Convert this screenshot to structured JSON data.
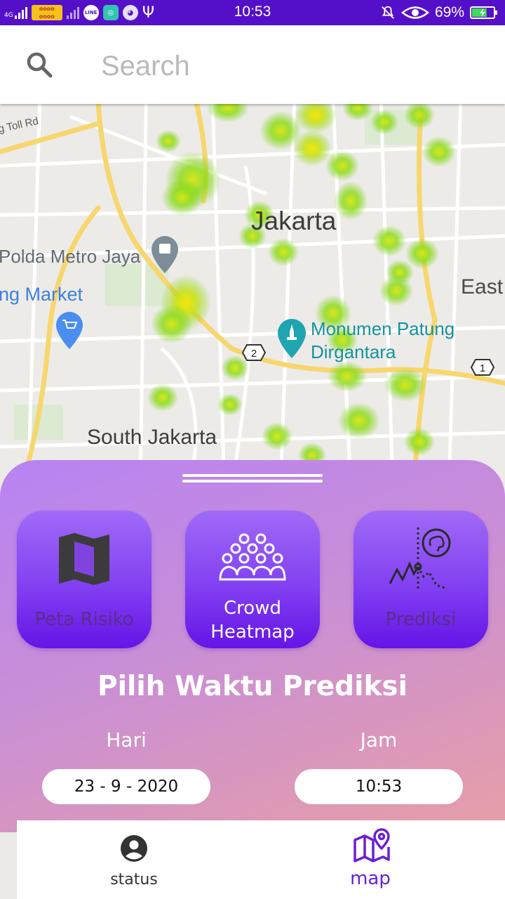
{
  "status_bar": {
    "network": "4G",
    "time": "10:53",
    "battery": "69%",
    "battery_level": 0.69,
    "icons": [
      "signal-icon",
      "carrier-logo-icon",
      "line-app-icon",
      "maps-app-icon",
      "android-debug-icon",
      "usb-icon",
      "mute-icon",
      "eye-comfort-icon",
      "battery-icon"
    ]
  },
  "search": {
    "placeholder": "Search",
    "icon": "search-icon"
  },
  "map": {
    "labels": {
      "toll": "g Toll Rd",
      "jakarta": "Jakarta",
      "polda": "Polda Metro Jaya",
      "market": "ng Market",
      "east": "East",
      "monumen_line1": "Monumen Patung",
      "monumen_line2": "Dirgantara",
      "south": "South Jakarta",
      "route_2": "2",
      "route_1": "1"
    },
    "colors": {
      "heat_green": "#7ed321",
      "heat_yellow": "#f5e50a",
      "road": "#ffffff",
      "highway": "#f7d66e",
      "pin_teal": "#1ea5b0",
      "pin_blue": "#4b8df0",
      "pin_gray": "#7d8c99"
    }
  },
  "sheet": {
    "buttons": [
      {
        "label": "Peta Risiko",
        "icon": "folded-map-icon",
        "active": false
      },
      {
        "label_line1": "Crowd",
        "label_line2": "Heatmap",
        "icon": "crowd-icon",
        "active": true
      },
      {
        "label": "Prediksi",
        "icon": "prediction-chart-icon",
        "active": false
      }
    ],
    "title": "Pilih Waktu Prediksi",
    "day_label": "Hari",
    "hour_label": "Jam",
    "day_value": "23 - 9 - 2020",
    "hour_value": "10:53",
    "colors": {
      "active_text": "#ffffff",
      "inactive_text": "#5a2e8a"
    }
  },
  "nav": {
    "items": [
      {
        "label": "status",
        "icon": "account-circle-icon",
        "active": false,
        "color": "#333333"
      },
      {
        "label": "map",
        "icon": "map-pin-icon",
        "active": true,
        "color": "#6a1fd6"
      }
    ]
  }
}
